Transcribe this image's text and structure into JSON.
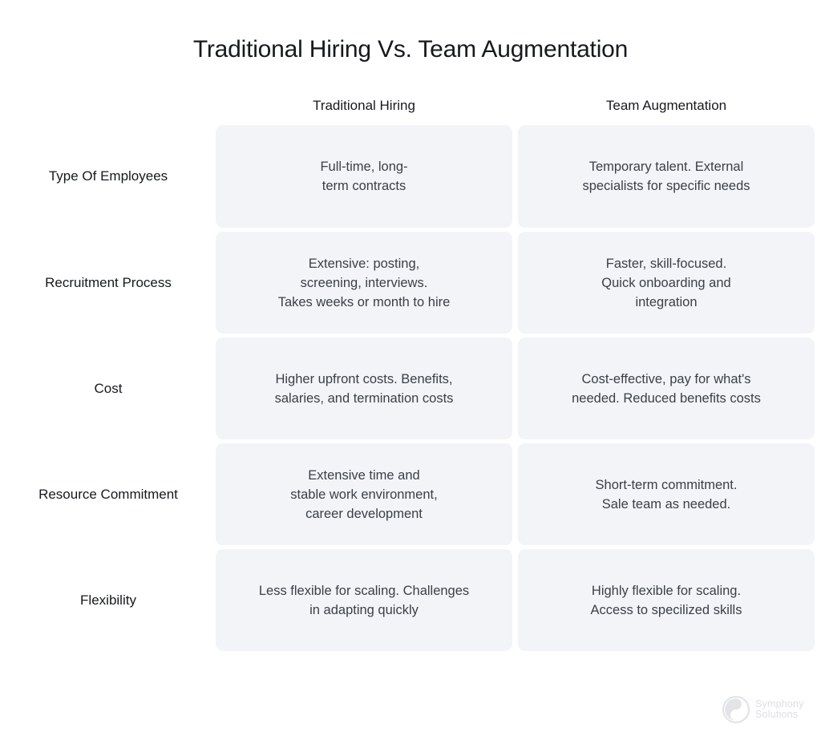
{
  "title": "Traditional Hiring Vs. Team Augmentation",
  "columns": {
    "row_label_header": "",
    "headers": [
      "Traditional Hiring",
      "Team Augmentation"
    ]
  },
  "rows": [
    {
      "label": "Type Of Employees",
      "traditional": "Full-time, long-\nterm contracts",
      "augmentation": "Temporary talent. External\nspecialists for specific needs"
    },
    {
      "label": "Recruitment Process",
      "traditional": "Extensive: posting,\nscreening, interviews.\nTakes weeks or month to hire",
      "augmentation": "Faster, skill-focused.\nQuick onboarding and\nintegration"
    },
    {
      "label": "Cost",
      "traditional": "Higher upfront costs. Benefits,\nsalaries, and termination costs",
      "augmentation": "Cost-effective, pay for what's\nneeded. Reduced benefits costs"
    },
    {
      "label": "Resource Commitment",
      "traditional": "Extensive time and\nstable work environment,\ncareer development",
      "augmentation": "Short-term commitment.\nSale team as needed."
    },
    {
      "label": "Flexibility",
      "traditional": "Less flexible for scaling. Challenges\nin adapting quickly",
      "augmentation": "Highly flexible for scaling.\nAccess to specilized skills"
    }
  ],
  "logo": {
    "line1": "Symphony",
    "line2": "Solutions"
  },
  "colors": {
    "page_background": "#ffffff",
    "cell_background": "#f3f4f8",
    "title_text": "#16191d",
    "cell_text": "#3b4046",
    "logo_gray": "#dcdee2"
  }
}
